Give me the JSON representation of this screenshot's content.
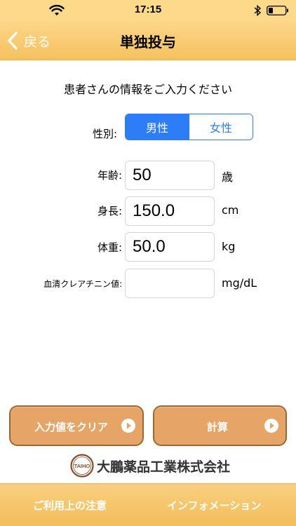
{
  "status_bar": {
    "time": "17:15"
  },
  "nav": {
    "back_label": "戻る",
    "title": "単独投与"
  },
  "form": {
    "instruction": "患者さんの情報をご入力ください",
    "gender": {
      "label": "性別:",
      "options": [
        "男性",
        "女性"
      ],
      "selected": "男性"
    },
    "age": {
      "label": "年齢:",
      "value": "50",
      "unit": "歳"
    },
    "height": {
      "label": "身長:",
      "value": "150.0",
      "unit": "cm"
    },
    "weight": {
      "label": "体重:",
      "value": "50.0",
      "unit": "kg"
    },
    "creatinine": {
      "label": "血清クレアチニン値:",
      "value": "",
      "unit": "mg/dL"
    }
  },
  "buttons": {
    "clear": "入力値をクリア",
    "calculate": "計算"
  },
  "logo": {
    "mark": "TAIHO",
    "company": "大鵬薬品工業株式会社"
  },
  "bottom": {
    "notice": "ご利用上の注意",
    "info": "インフォメーション"
  },
  "colors": {
    "accent": "#2c7df6",
    "button": "#e6a466",
    "bar": "#f6c15f"
  }
}
